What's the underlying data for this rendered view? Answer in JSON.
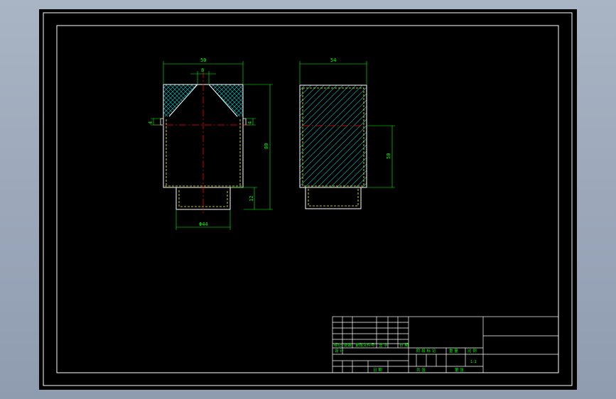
{
  "colors": {
    "background_outer": "#9aa7ba",
    "canvas": "#000000",
    "frame": "#ffffff",
    "outline": "#ffffff",
    "hidden_line": "#ffff00",
    "dimension": "#00ff00",
    "centerline": "#ff0000",
    "hatch": "#00d0d0"
  },
  "views": {
    "left": {
      "dim_top_width": "50",
      "dim_small_top": "8",
      "dim_height": "80",
      "dim_left_small": "4",
      "dim_right_small": "4",
      "dim_step": "12",
      "dim_bottom_dia": "Φ44"
    },
    "right": {
      "dim_top_width": "54",
      "dim_right_height": "50"
    }
  },
  "title_block": {
    "rev_headers": [
      "标记",
      "处数",
      "更改文件号",
      "签 字",
      "日 期"
    ],
    "designer_label": "设 计",
    "review_label": "审 核",
    "process_label": "工 艺",
    "approve_label": "批 准",
    "stage_label": "阶 段 标 记",
    "weight_label": "重 量",
    "scale_label": "比 例",
    "scale_value": "1:1",
    "sheet_label": "共    张",
    "sheet_of_label": "第    张",
    "date_label": "日 期"
  }
}
